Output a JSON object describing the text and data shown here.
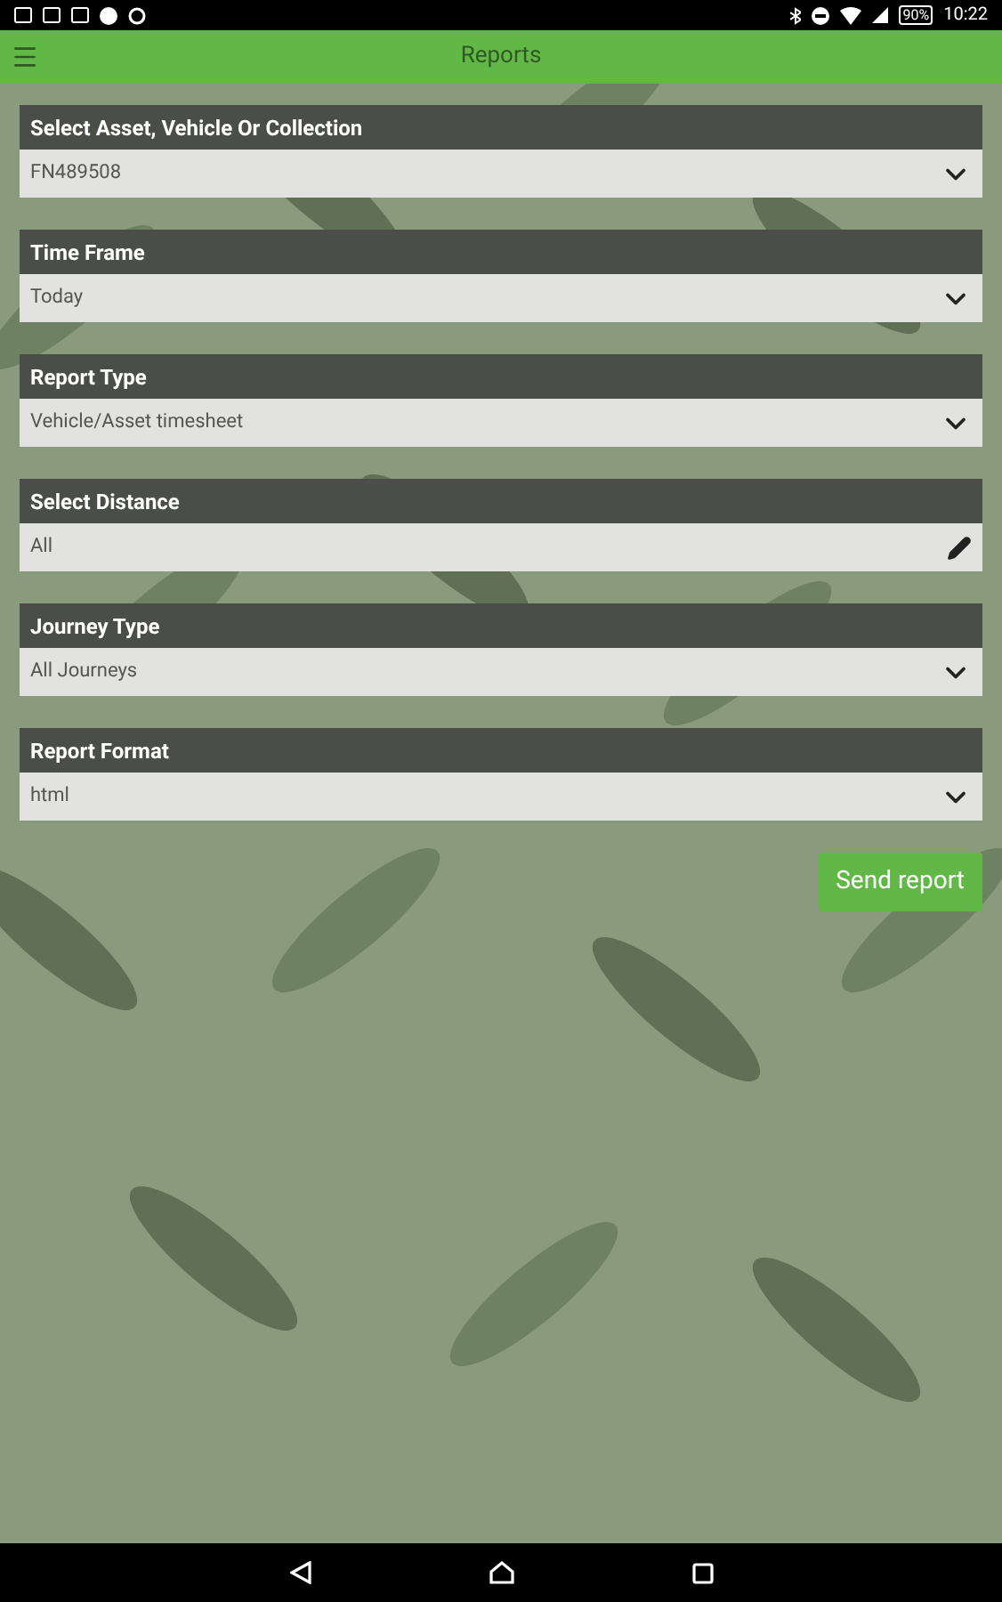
{
  "status_bar": {
    "battery": "90%",
    "time": "10:22"
  },
  "app_bar": {
    "title": "Reports"
  },
  "fields": [
    {
      "label": "Select Asset, Vehicle Or Collection",
      "value": "FN489508",
      "kind": "select"
    },
    {
      "label": "Time Frame",
      "value": "Today",
      "kind": "select"
    },
    {
      "label": "Report Type",
      "value": "Vehicle/Asset timesheet",
      "kind": "select"
    },
    {
      "label": "Select Distance",
      "value": "All",
      "kind": "edit"
    },
    {
      "label": "Journey Type",
      "value": "All Journeys",
      "kind": "select"
    },
    {
      "label": "Report Format",
      "value": "html",
      "kind": "select"
    }
  ],
  "send_button": {
    "label": "Send report"
  }
}
